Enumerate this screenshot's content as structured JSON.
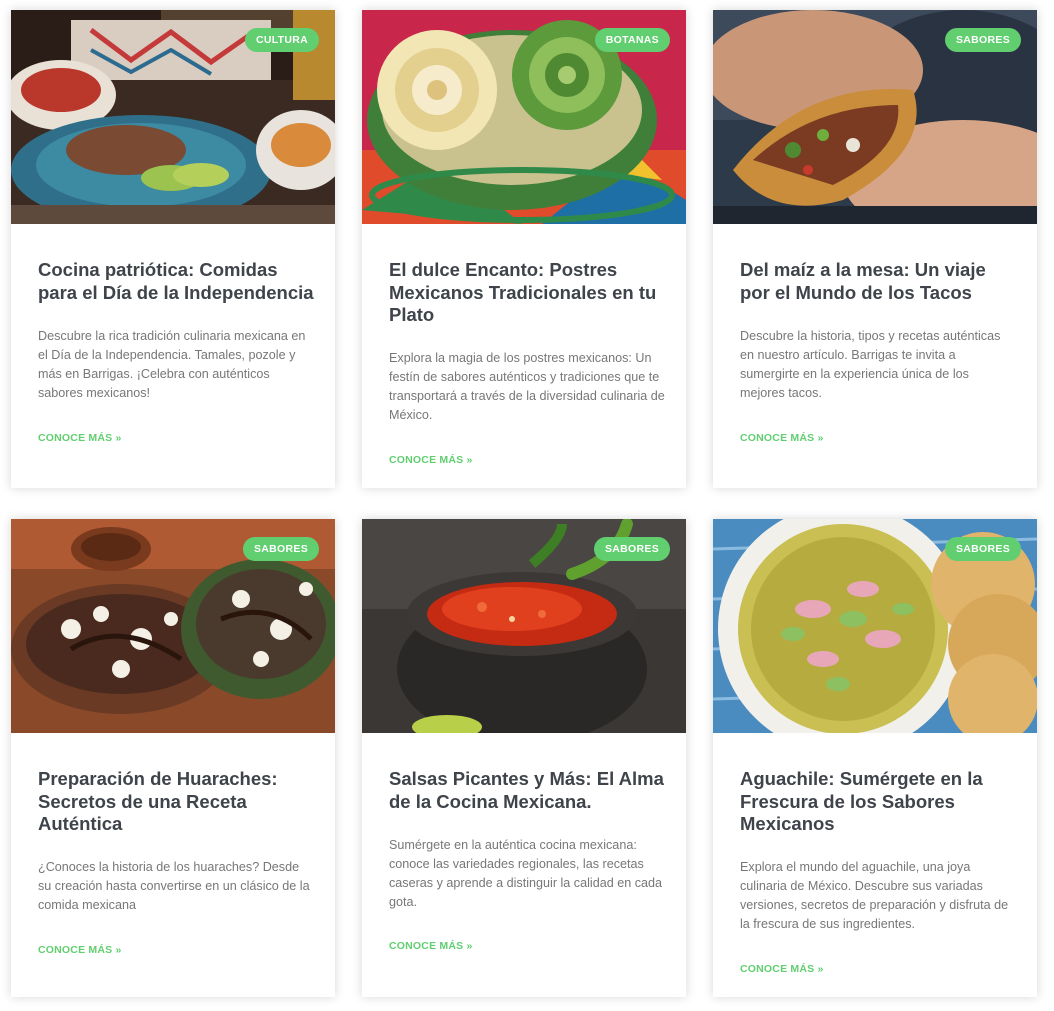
{
  "accent_color": "#61ce70",
  "posts": [
    {
      "category": "CULTURA",
      "title": "Cocina patriótica: Comidas para el Día de la Independencia",
      "excerpt": "Descubre la rica tradición culinaria mexicana en el Día de la Independencia. Tamales, pozole y más en Barrigas. ¡Celebra con auténticos sabores mexicanos!",
      "read_more": "CONOCE MÁS »",
      "image": "mexican-independence-day-dishes-photo"
    },
    {
      "category": "BOTANAS",
      "title": "El dulce Encanto: Postres Mexicanos Tradicionales en tu Plato",
      "excerpt": "Explora la magia de los postres mexicanos: Un festín de sabores auténticos y tradiciones que te transportará a través de la diversidad culinaria de México.",
      "read_more": "CONOCE MÁS »",
      "image": "mexican-candy-rolls-basket-photo"
    },
    {
      "category": "SABORES",
      "title": "Del maíz a la mesa: Un viaje por el Mundo de los Tacos",
      "excerpt": "Descubre la historia, tipos y recetas auténticas en nuestro artículo. Barrigas te invita a sumergirte en la experiencia única de los mejores tacos.",
      "read_more": "CONOCE MÁS »",
      "image": "hands-holding-taco-photo"
    },
    {
      "category": "SABORES",
      "title": "Preparación de Huaraches: Secretos de una Receta Auténtica",
      "excerpt": "¿Conoces la historia de los huaraches? Desde su creación hasta convertirse en un clásico de la comida mexicana",
      "read_more": "CONOCE MÁS »",
      "image": "huaraches-with-cheese-photo"
    },
    {
      "category": "SABORES",
      "title": "Salsas Picantes y Más: El Alma de la Cocina Mexicana.",
      "excerpt": "Sumérgete en la auténtica cocina mexicana: conoce las variedades regionales, las recetas caseras y aprende a distinguir la calidad en cada gota.",
      "read_more": "CONOCE MÁS »",
      "image": "salsa-in-molcajete-photo"
    },
    {
      "category": "SABORES",
      "title": "Aguachile: Sumérgete en la Frescura de los Sabores Mexicanos",
      "excerpt": "Explora el mundo del aguachile, una joya culinaria de México. Descubre sus variadas versiones, secretos de preparación y disfruta de la frescura de sus ingredientes.",
      "read_more": "CONOCE MÁS »",
      "image": "aguachile-bowl-with-tostadas-photo"
    }
  ]
}
